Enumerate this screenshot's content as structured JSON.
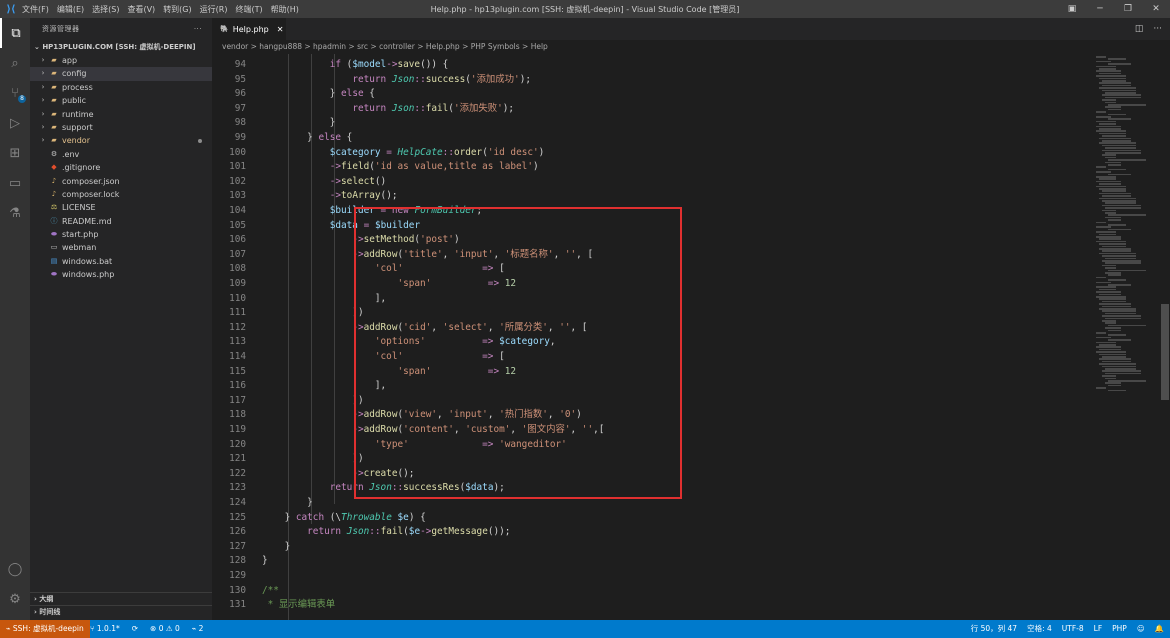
{
  "titlebar": {
    "menu": [
      "文件(F)",
      "编辑(E)",
      "选择(S)",
      "查看(V)",
      "转到(G)",
      "运行(R)",
      "终端(T)",
      "帮助(H)"
    ],
    "title": "Help.php - hp13plugin.com [SSH: 虚拟机-deepin] - Visual Studio Code [管理员]"
  },
  "activity": {
    "scm_badge": "8"
  },
  "sidebar": {
    "header": "资源管理器",
    "project": "HP13PLUGIN.COM [SSH: 虚拟机-DEEPIN]",
    "items": [
      {
        "name": "app",
        "type": "folder",
        "icon": "folder-icon"
      },
      {
        "name": "config",
        "type": "folder",
        "icon": "folder-icon",
        "selected": true
      },
      {
        "name": "process",
        "type": "folder",
        "icon": "folder-icon"
      },
      {
        "name": "public",
        "type": "folder",
        "icon": "folder-icon"
      },
      {
        "name": "runtime",
        "type": "folder",
        "icon": "folder-icon"
      },
      {
        "name": "support",
        "type": "folder",
        "icon": "folder-icon"
      },
      {
        "name": "vendor",
        "type": "folder",
        "icon": "folder-icon",
        "modified": true
      },
      {
        "name": ".env",
        "type": "file",
        "icon": "gear-icon"
      },
      {
        "name": ".gitignore",
        "type": "file",
        "icon": "git-icon"
      },
      {
        "name": "composer.json",
        "type": "file",
        "icon": "composer-icon"
      },
      {
        "name": "composer.lock",
        "type": "file",
        "icon": "composer-icon"
      },
      {
        "name": "LICENSE",
        "type": "file",
        "icon": "license-icon"
      },
      {
        "name": "README.md",
        "type": "file",
        "icon": "info-icon"
      },
      {
        "name": "start.php",
        "type": "file",
        "icon": "php-icon"
      },
      {
        "name": "webman",
        "type": "file",
        "icon": "file-icon"
      },
      {
        "name": "windows.bat",
        "type": "file",
        "icon": "terminal-icon"
      },
      {
        "name": "windows.php",
        "type": "file",
        "icon": "php-icon"
      }
    ],
    "outline": "大纲",
    "timeline": "时间线"
  },
  "tab": {
    "label": "Help.php"
  },
  "breadcrumb": "vendor > hangpu888 > hpadmin > src > controller > Help.php > PHP Symbols > Help",
  "code": [
    {
      "n": "94",
      "t": "            if ($model->save()) {"
    },
    {
      "n": "95",
      "t": "                return Json::success('添加成功');"
    },
    {
      "n": "96",
      "t": "            } else {"
    },
    {
      "n": "97",
      "t": "                return Json::fail('添加失败');"
    },
    {
      "n": "98",
      "t": "            }"
    },
    {
      "n": "99",
      "t": "        } else {"
    },
    {
      "n": "100",
      "t": "            $category = HelpCate::order('id desc')"
    },
    {
      "n": "101",
      "t": "            ->field('id as value,title as label')"
    },
    {
      "n": "102",
      "t": "            ->select()"
    },
    {
      "n": "103",
      "t": "            ->toArray();"
    },
    {
      "n": "104",
      "t": "            $builder = new FormBuilder;"
    },
    {
      "n": "105",
      "t": "            $data = $builder"
    },
    {
      "n": "106",
      "t": "                ->setMethod('post')"
    },
    {
      "n": "107",
      "t": "                ->addRow('title', 'input', '标题名称', '', ["
    },
    {
      "n": "108",
      "t": "                    'col'              => ["
    },
    {
      "n": "109",
      "t": "                        'span'          => 12"
    },
    {
      "n": "110",
      "t": "                    ],"
    },
    {
      "n": "111",
      "t": "                ])"
    },
    {
      "n": "112",
      "t": "                ->addRow('cid', 'select', '所属分类', '', ["
    },
    {
      "n": "113",
      "t": "                    'options'          => $category,"
    },
    {
      "n": "114",
      "t": "                    'col'              => ["
    },
    {
      "n": "115",
      "t": "                        'span'          => 12"
    },
    {
      "n": "116",
      "t": "                    ],"
    },
    {
      "n": "117",
      "t": "                ])"
    },
    {
      "n": "118",
      "t": "                ->addRow('view', 'input', '热门指数', '0')"
    },
    {
      "n": "119",
      "t": "                ->addRow('content', 'custom', '图文内容', '',["
    },
    {
      "n": "120",
      "t": "                    'type'             => 'wangeditor'"
    },
    {
      "n": "121",
      "t": "                ])"
    },
    {
      "n": "122",
      "t": "                ->create();"
    },
    {
      "n": "123",
      "t": "            return Json::successRes($data);"
    },
    {
      "n": "124",
      "t": "        }"
    },
    {
      "n": "125",
      "t": "    } catch (\\Throwable $e) {"
    },
    {
      "n": "126",
      "t": "        return Json::fail($e->getMessage());"
    },
    {
      "n": "127",
      "t": "    }"
    },
    {
      "n": "128",
      "t": "}"
    },
    {
      "n": "129",
      "t": ""
    },
    {
      "n": "130",
      "t": "/**"
    },
    {
      "n": "131",
      "t": " * 显示编辑表单"
    }
  ],
  "statusbar": {
    "remote": "SSH: 虚拟机-deepin",
    "branch": "1.0.1*",
    "problems": "⊗ 0 ⚠ 0",
    "ports": "2",
    "position": "行 50，列 47",
    "spaces": "空格: 4",
    "encoding": "UTF-8",
    "eol": "LF",
    "language": "PHP"
  }
}
